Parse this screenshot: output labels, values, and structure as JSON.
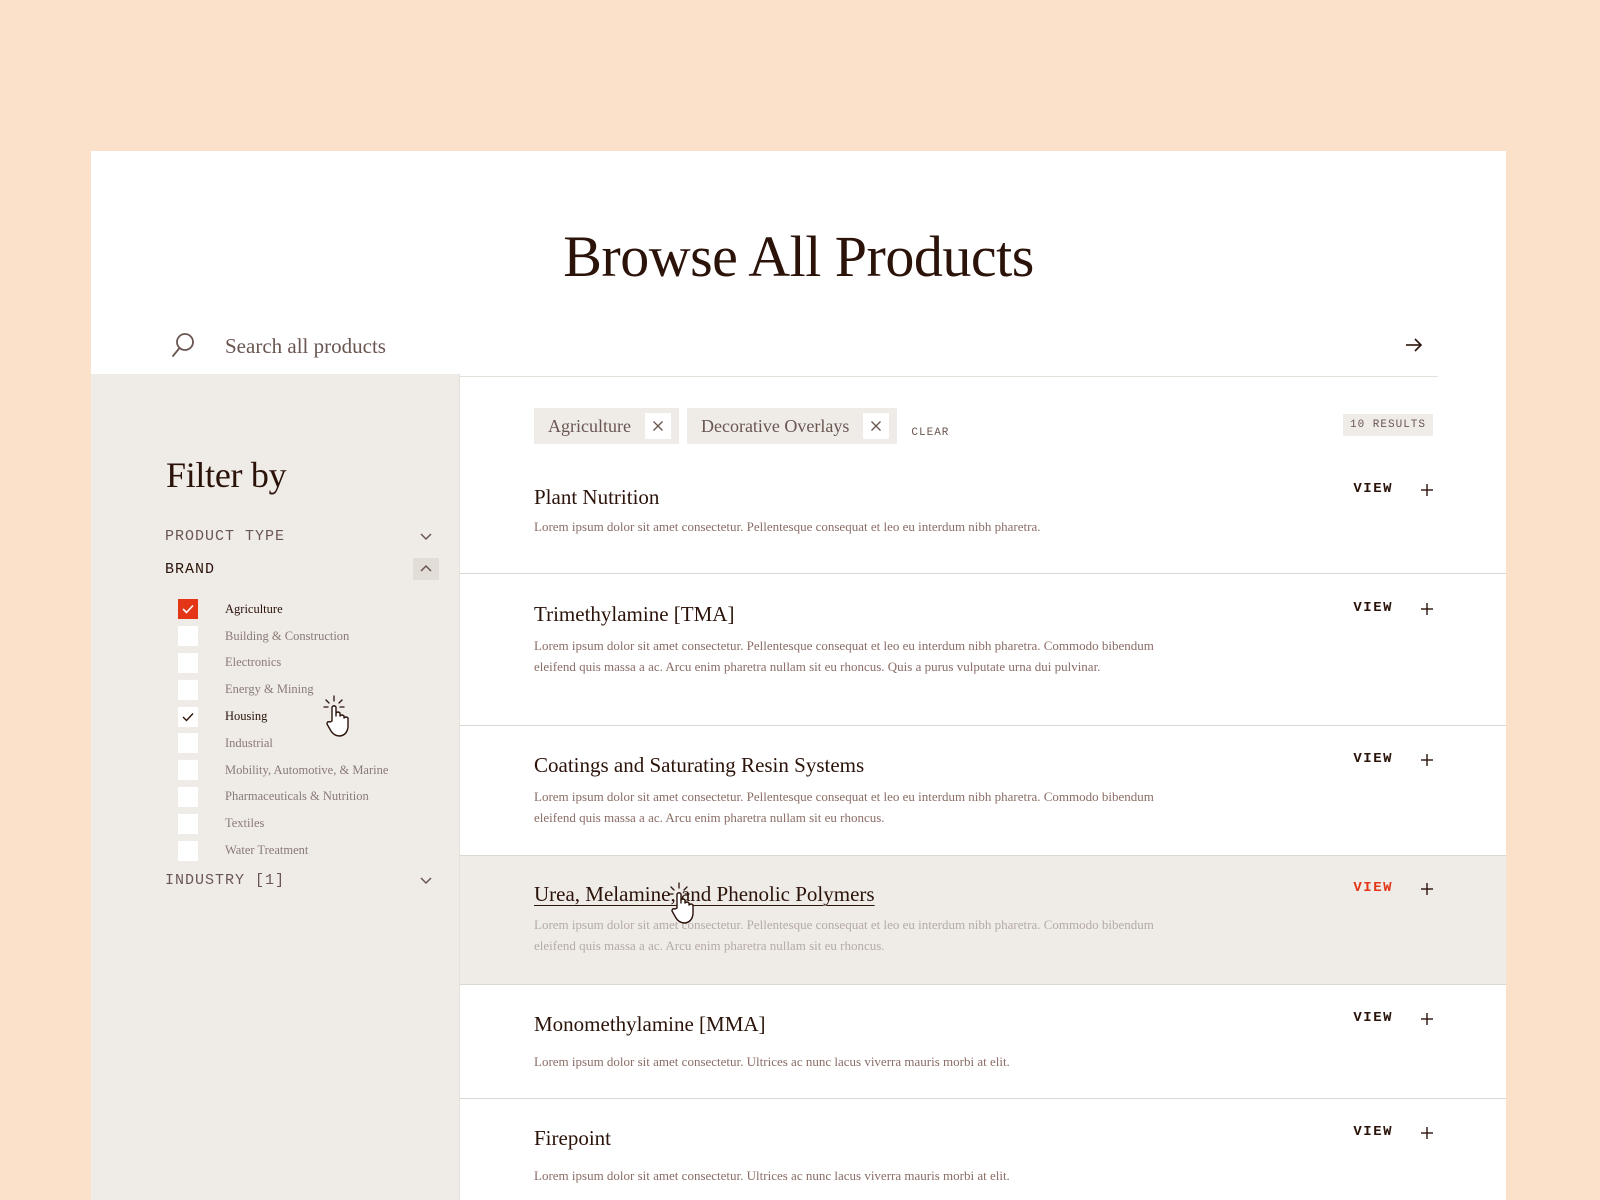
{
  "page": {
    "title": "Browse All Products"
  },
  "search": {
    "placeholder": "Search all products",
    "icon": "search-icon",
    "submit_icon": "arrow-right-icon"
  },
  "filters": {
    "title": "Filter by",
    "product_type_label": "PRODUCT TYPE",
    "brand_label": "BRAND",
    "industry_label": "INDUSTRY [1]",
    "brand_items": [
      {
        "label": "Agriculture",
        "state": "checked-accent"
      },
      {
        "label": "Building & Construction",
        "state": "unchecked"
      },
      {
        "label": "Electronics",
        "state": "unchecked"
      },
      {
        "label": "Energy & Mining",
        "state": "unchecked"
      },
      {
        "label": "Housing",
        "state": "checked-hover"
      },
      {
        "label": "Industrial",
        "state": "unchecked"
      },
      {
        "label": "Mobility, Automotive, & Marine",
        "state": "unchecked"
      },
      {
        "label": "Pharmaceuticals & Nutrition",
        "state": "unchecked"
      },
      {
        "label": "Textiles",
        "state": "unchecked"
      },
      {
        "label": "Water Treatment",
        "state": "unchecked"
      }
    ]
  },
  "active_filters": {
    "chips": [
      {
        "label": "Agriculture"
      },
      {
        "label": "Decorative Overlays"
      }
    ],
    "clear_label": "CLEAR",
    "result_count": "10 RESULTS"
  },
  "products": [
    {
      "title": "Plant Nutrition",
      "description": "Lorem ipsum dolor sit amet consectetur. Pellentesque consequat et leo eu interdum nibh pharetra.",
      "view_label": "VIEW"
    },
    {
      "title": "Trimethylamine [TMA]",
      "description": "Lorem ipsum dolor sit amet consectetur. Pellentesque consequat et leo eu interdum nibh pharetra. Commodo bibendum eleifend quis massa a ac. Arcu enim pharetra nullam sit eu rhoncus. Quis a purus vulputate urna dui pulvinar.",
      "view_label": "VIEW"
    },
    {
      "title": "Coatings and Saturating Resin Systems",
      "description": "Lorem ipsum dolor sit amet consectetur. Pellentesque consequat et leo eu interdum nibh pharetra. Commodo bibendum eleifend quis massa a ac. Arcu enim pharetra nullam sit eu rhoncus.",
      "view_label": "VIEW"
    },
    {
      "title": "Urea, Melamine, and Phenolic Polymers",
      "description": "Lorem ipsum dolor sit amet consectetur. Pellentesque consequat et leo eu interdum nibh pharetra. Commodo bibendum eleifend quis massa a ac. Arcu enim pharetra nullam sit eu rhoncus.",
      "view_label": "VIEW"
    },
    {
      "title": "Monomethylamine [MMA]",
      "description": "Lorem ipsum dolor sit amet consectetur. Ultrices ac nunc lacus viverra mauris morbi at elit.",
      "view_label": "VIEW"
    },
    {
      "title": "Firepoint",
      "description": "Lorem ipsum dolor sit amet consectetur. Ultrices ac nunc lacus viverra mauris morbi at elit.",
      "view_label": "VIEW"
    }
  ],
  "colors": {
    "background": "#fbe1c9",
    "panel": "#efece8",
    "ink": "#2b130a",
    "accent": "#e53517"
  }
}
